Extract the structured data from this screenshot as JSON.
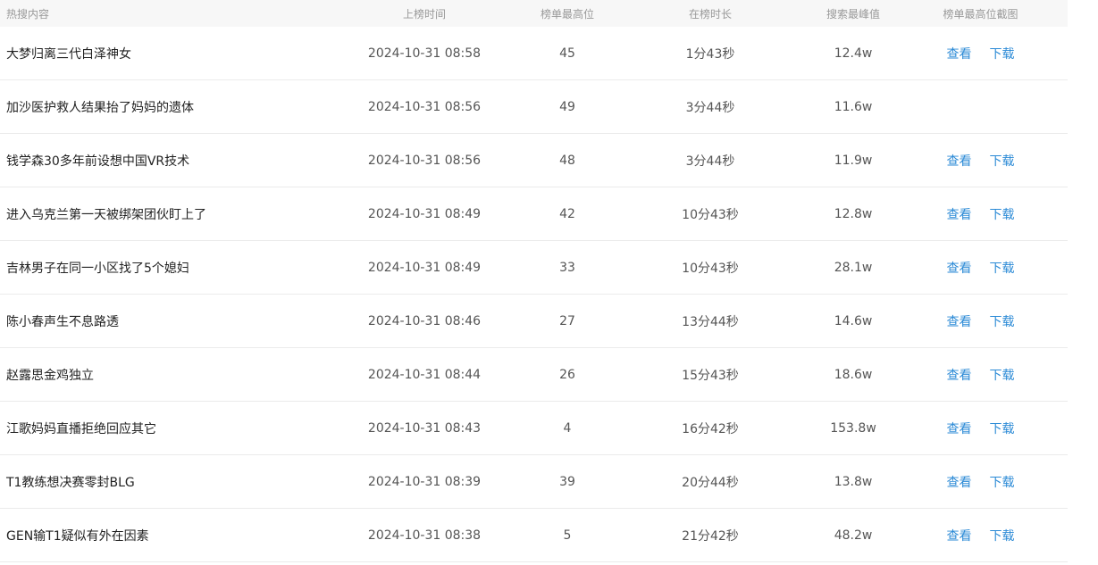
{
  "table": {
    "headers": [
      "热搜内容",
      "上榜时间",
      "榜单最高位",
      "在榜时长",
      "搜索最峰值",
      "榜单最高位截图"
    ],
    "view_label": "查看",
    "download_label": "下载",
    "rows": [
      {
        "topic": "大梦归离三代白泽神女",
        "time": "2024-10-31 08:58",
        "rank": "45",
        "duration": "1分43秒",
        "peak": "12.4w",
        "has_screenshot": true
      },
      {
        "topic": "加沙医护救人结果抬了妈妈的遗体",
        "time": "2024-10-31 08:56",
        "rank": "49",
        "duration": "3分44秒",
        "peak": "11.6w",
        "has_screenshot": false
      },
      {
        "topic": "钱学森30多年前设想中国VR技术",
        "time": "2024-10-31 08:56",
        "rank": "48",
        "duration": "3分44秒",
        "peak": "11.9w",
        "has_screenshot": true
      },
      {
        "topic": "进入乌克兰第一天被绑架团伙盯上了",
        "time": "2024-10-31 08:49",
        "rank": "42",
        "duration": "10分43秒",
        "peak": "12.8w",
        "has_screenshot": true
      },
      {
        "topic": "吉林男子在同一小区找了5个媳妇",
        "time": "2024-10-31 08:49",
        "rank": "33",
        "duration": "10分43秒",
        "peak": "28.1w",
        "has_screenshot": true
      },
      {
        "topic": "陈小春声生不息路透",
        "time": "2024-10-31 08:46",
        "rank": "27",
        "duration": "13分44秒",
        "peak": "14.6w",
        "has_screenshot": true
      },
      {
        "topic": "赵露思金鸡独立",
        "time": "2024-10-31 08:44",
        "rank": "26",
        "duration": "15分43秒",
        "peak": "18.6w",
        "has_screenshot": true
      },
      {
        "topic": "江歌妈妈直播拒绝回应其它",
        "time": "2024-10-31 08:43",
        "rank": "4",
        "duration": "16分42秒",
        "peak": "153.8w",
        "has_screenshot": true
      },
      {
        "topic": "T1教练想决赛零封BLG",
        "time": "2024-10-31 08:39",
        "rank": "39",
        "duration": "20分44秒",
        "peak": "13.8w",
        "has_screenshot": true
      },
      {
        "topic": "GEN输T1疑似有外在因素",
        "time": "2024-10-31 08:38",
        "rank": "5",
        "duration": "21分42秒",
        "peak": "48.2w",
        "has_screenshot": true
      }
    ]
  }
}
